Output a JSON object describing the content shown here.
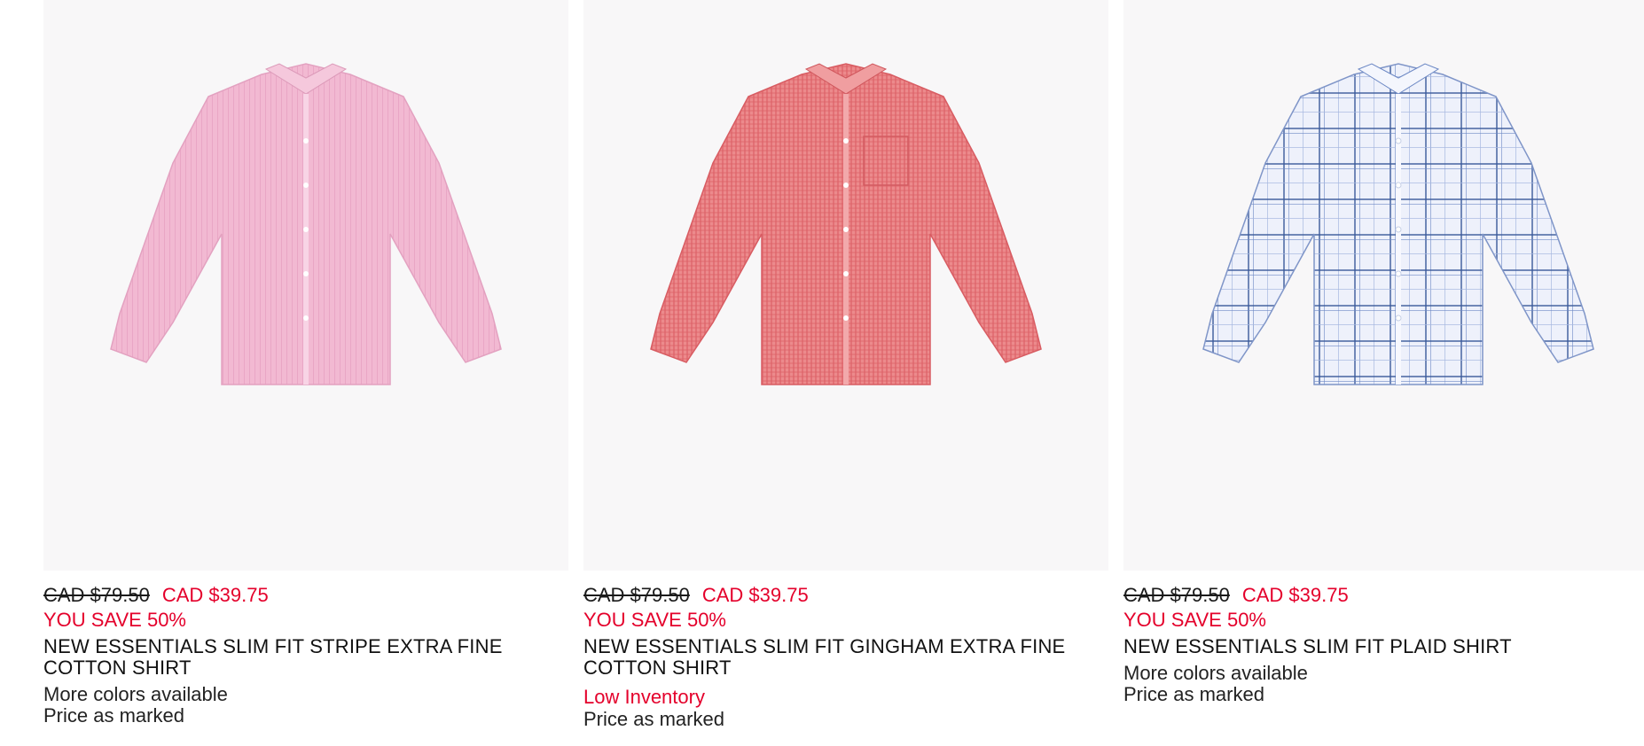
{
  "colors": {
    "accent": "#e4002b",
    "tile_bg": "#f8f7f8",
    "text": "#111111"
  },
  "products": [
    {
      "image_alt": "pink striped dress shirt",
      "shirt_color": "#f2b9d2",
      "shirt_line": "#e79fc0",
      "old_price": "CAD $79.50",
      "sale_price": "CAD $39.75",
      "savings": "YOU SAVE 50%",
      "name": "NEW ESSENTIALS SLIM FIT STRIPE EXTRA FINE COTTON SHIRT",
      "colors_note": "More colors available",
      "price_note": "Price as marked"
    },
    {
      "image_alt": "red gingham dress shirt",
      "shirt_color": "#e8787b",
      "shirt_line": "#d9585d",
      "old_price": "CAD $79.50",
      "sale_price": "CAD $39.75",
      "savings": "YOU SAVE 50%",
      "name": "NEW ESSENTIALS SLIM FIT GINGHAM EXTRA FINE COTTON SHIRT",
      "inventory": "Low Inventory",
      "price_note": "Price as marked"
    },
    {
      "image_alt": "blue plaid dress shirt",
      "shirt_color": "#eef1fb",
      "shirt_line": "#3b5a9a",
      "old_price": "CAD $79.50",
      "sale_price": "CAD $39.75",
      "savings": "YOU SAVE 50%",
      "name": "NEW ESSENTIALS SLIM FIT PLAID SHIRT",
      "colors_note": "More colors available",
      "price_note": "Price as marked"
    }
  ]
}
